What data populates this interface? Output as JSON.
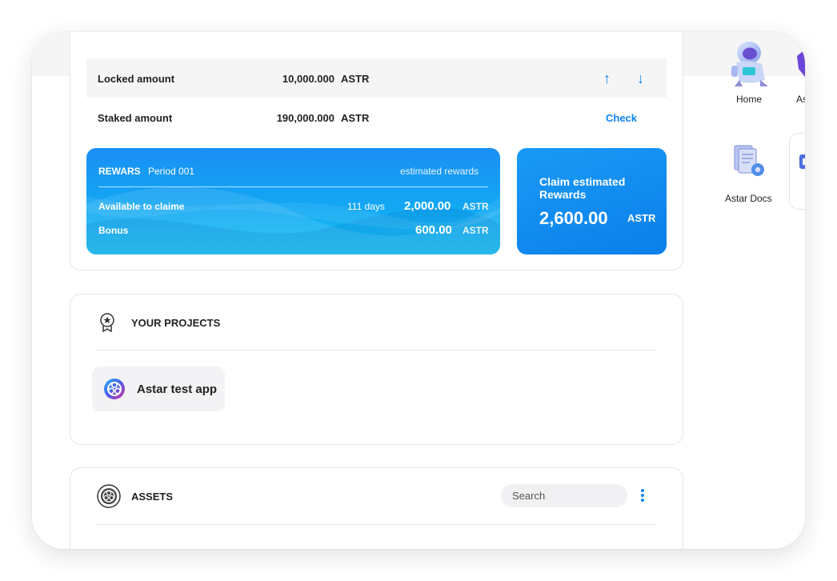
{
  "staking": {
    "locked": {
      "label": "Locked amount",
      "value": "10,000.000",
      "unit": "ASTR"
    },
    "staked": {
      "label": "Staked amount",
      "value": "190,000.000",
      "unit": "ASTR",
      "action": "Check"
    },
    "arrows": {
      "up": "↑",
      "down": "↓"
    }
  },
  "rewards": {
    "title": "REWARS",
    "period": "Period 001",
    "estimated_label": "estimated rewards",
    "available_label": "Available to claime",
    "days": "111 days",
    "available_value": "2,000.00",
    "available_unit": "ASTR",
    "bonus_label": "Bonus",
    "bonus_value": "600.00",
    "bonus_unit": "ASTR"
  },
  "claim": {
    "title": "Claim  estimated Rewards",
    "amount": "2,600.00",
    "unit": "ASTR"
  },
  "projects": {
    "title": "YOUR PROJECTS",
    "items": [
      {
        "name": "Astar test app"
      }
    ]
  },
  "assets": {
    "title": "ASSETS",
    "search_placeholder": "Search"
  },
  "sidebar": {
    "items": [
      {
        "label": "Home"
      },
      {
        "label": "As"
      },
      {
        "label": "Astar Docs"
      }
    ]
  },
  "colors": {
    "accent": "#0b84f0",
    "rewards_gradient_top": "#1a8ff5",
    "rewards_gradient_bottom": "#17c2f0"
  }
}
